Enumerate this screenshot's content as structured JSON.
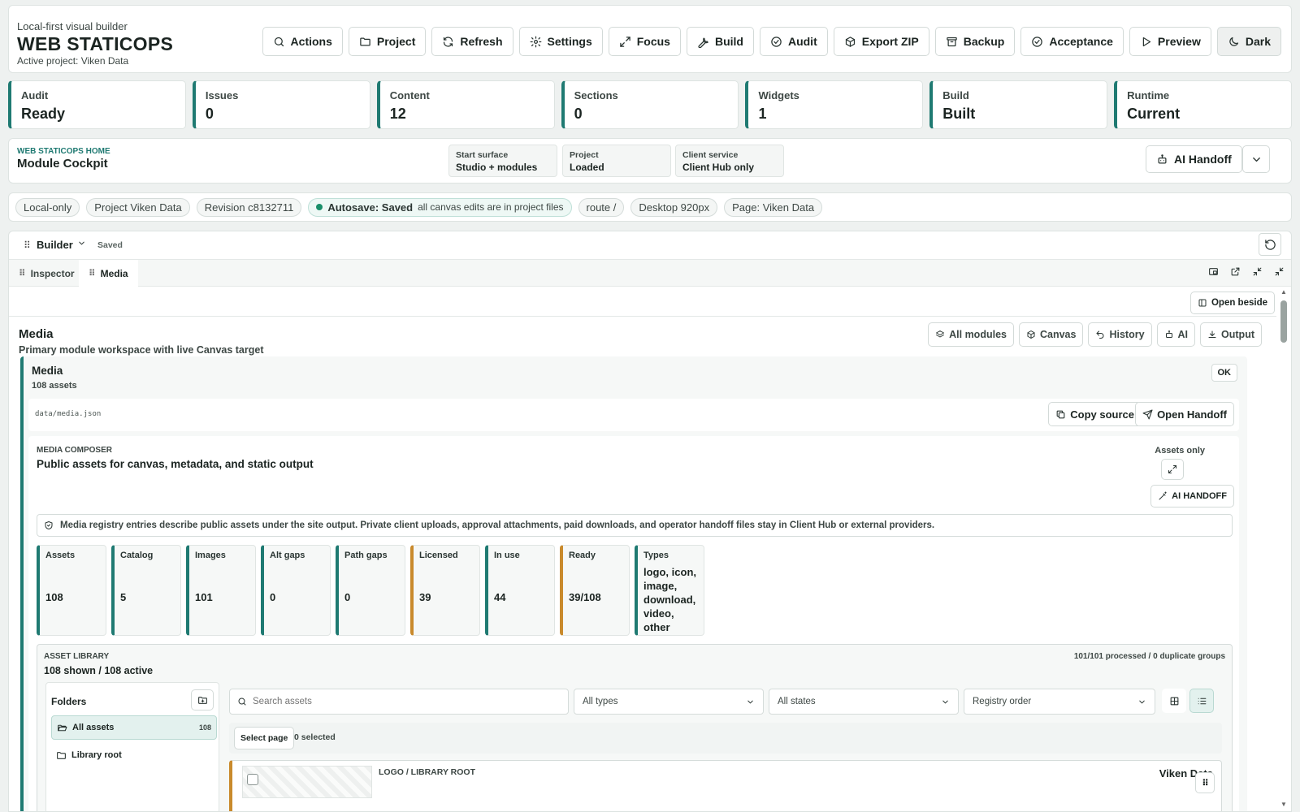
{
  "header": {
    "eyebrow": "Local-first visual builder",
    "app_title": "WEB STATICOPS",
    "active_project": "Active project: Viken Data",
    "toolbar": [
      {
        "label": "Actions",
        "icon": "search-icon"
      },
      {
        "label": "Project",
        "icon": "folder-icon"
      },
      {
        "label": "Refresh",
        "icon": "refresh-icon"
      },
      {
        "label": "Settings",
        "icon": "gear-icon"
      },
      {
        "label": "Focus",
        "icon": "expand-icon"
      },
      {
        "label": "Build",
        "icon": "wrench-icon"
      },
      {
        "label": "Audit",
        "icon": "check-circle-icon"
      },
      {
        "label": "Export ZIP",
        "icon": "package-icon"
      },
      {
        "label": "Backup",
        "icon": "archive-icon"
      },
      {
        "label": "Acceptance",
        "icon": "check-circle-icon"
      },
      {
        "label": "Preview",
        "icon": "play-icon"
      },
      {
        "label": "Dark",
        "icon": "moon-icon"
      }
    ]
  },
  "stats": [
    {
      "label": "Audit",
      "value": "Ready"
    },
    {
      "label": "Issues",
      "value": "0"
    },
    {
      "label": "Content",
      "value": "12"
    },
    {
      "label": "Sections",
      "value": "0"
    },
    {
      "label": "Widgets",
      "value": "1"
    },
    {
      "label": "Build",
      "value": "Built"
    },
    {
      "label": "Runtime",
      "value": "Current"
    }
  ],
  "home": {
    "kicker": "WEB STATICOPS HOME",
    "title": "Module Cockpit",
    "surfaces": [
      {
        "label": "Start surface",
        "value": "Studio + modules"
      },
      {
        "label": "Project",
        "value": "Loaded"
      },
      {
        "label": "Client service",
        "value": "Client Hub only"
      }
    ],
    "ai_handoff": "AI Handoff"
  },
  "chips": {
    "local": "Local-only",
    "project": "Project Viken Data",
    "revision": "Revision c8132711",
    "autosave_label": "Autosave: Saved",
    "autosave_note": "all canvas edits are in project files",
    "route": "route /",
    "viewport": "Desktop 920px",
    "page": "Page: Viken Data"
  },
  "builder": {
    "title": "Builder",
    "status": "Saved",
    "tabs": [
      "Inspector",
      "Media"
    ],
    "open_beside": "Open beside",
    "media_title": "Media",
    "media_subtitle": "Primary module workspace with live Canvas target",
    "module_buttons": [
      {
        "label": "All modules",
        "icon": "layers-icon"
      },
      {
        "label": "Canvas",
        "icon": "cube-icon"
      },
      {
        "label": "History",
        "icon": "undo-icon"
      },
      {
        "label": "AI",
        "icon": "robot-icon"
      },
      {
        "label": "Output",
        "icon": "download-icon"
      }
    ]
  },
  "module": {
    "title": "Media",
    "count": "108 assets",
    "ok": "OK",
    "source_path": "data/media.json",
    "copy_source": "Copy source",
    "open_handoff": "Open Handoff"
  },
  "composer": {
    "kicker": "MEDIA COMPOSER",
    "title": "Public assets for canvas, metadata, and static output",
    "assets_only": "Assets only",
    "ai_handoff": "AI HANDOFF",
    "notice": "Media registry entries describe public assets under the site output. Private client uploads, approval attachments, paid downloads, and operator handoff files stay in Client Hub or external providers.",
    "metrics": [
      {
        "label": "Assets",
        "value": "108",
        "accent": "#1f7a72"
      },
      {
        "label": "Catalog",
        "value": "5",
        "accent": "#1f7a72"
      },
      {
        "label": "Images",
        "value": "101",
        "accent": "#1f7a72"
      },
      {
        "label": "Alt gaps",
        "value": "0",
        "accent": "#1f7a72"
      },
      {
        "label": "Path gaps",
        "value": "0",
        "accent": "#1f7a72"
      },
      {
        "label": "Licensed",
        "value": "39",
        "accent": "#c98a2c"
      },
      {
        "label": "In use",
        "value": "44",
        "accent": "#1f7a72"
      },
      {
        "label": "Ready",
        "value": "39/108",
        "accent": "#c98a2c"
      },
      {
        "label": "Types",
        "value": "logo, icon, image, download, video, other",
        "accent": "#1f7a72"
      }
    ]
  },
  "library": {
    "kicker": "ASSET LIBRARY",
    "summary": "108 shown / 108 active",
    "processed": "101/101 processed / 0 duplicate groups",
    "folders_title": "Folders",
    "folders": [
      {
        "label": "All assets",
        "count": "108",
        "selected": true
      },
      {
        "label": "Library root",
        "count": "",
        "selected": false
      }
    ],
    "search_placeholder": "Search assets",
    "type_filter": "All types",
    "state_filter": "All states",
    "order": "Registry order",
    "select_page": "Select page",
    "selected": "0 selected",
    "asset_path": "LOGO / LIBRARY ROOT",
    "asset_name": "Viken Data"
  },
  "colors": {
    "accent": "#1f7a72",
    "warning": "#c98a2c",
    "autosave_dot": "#1a8f6a"
  }
}
